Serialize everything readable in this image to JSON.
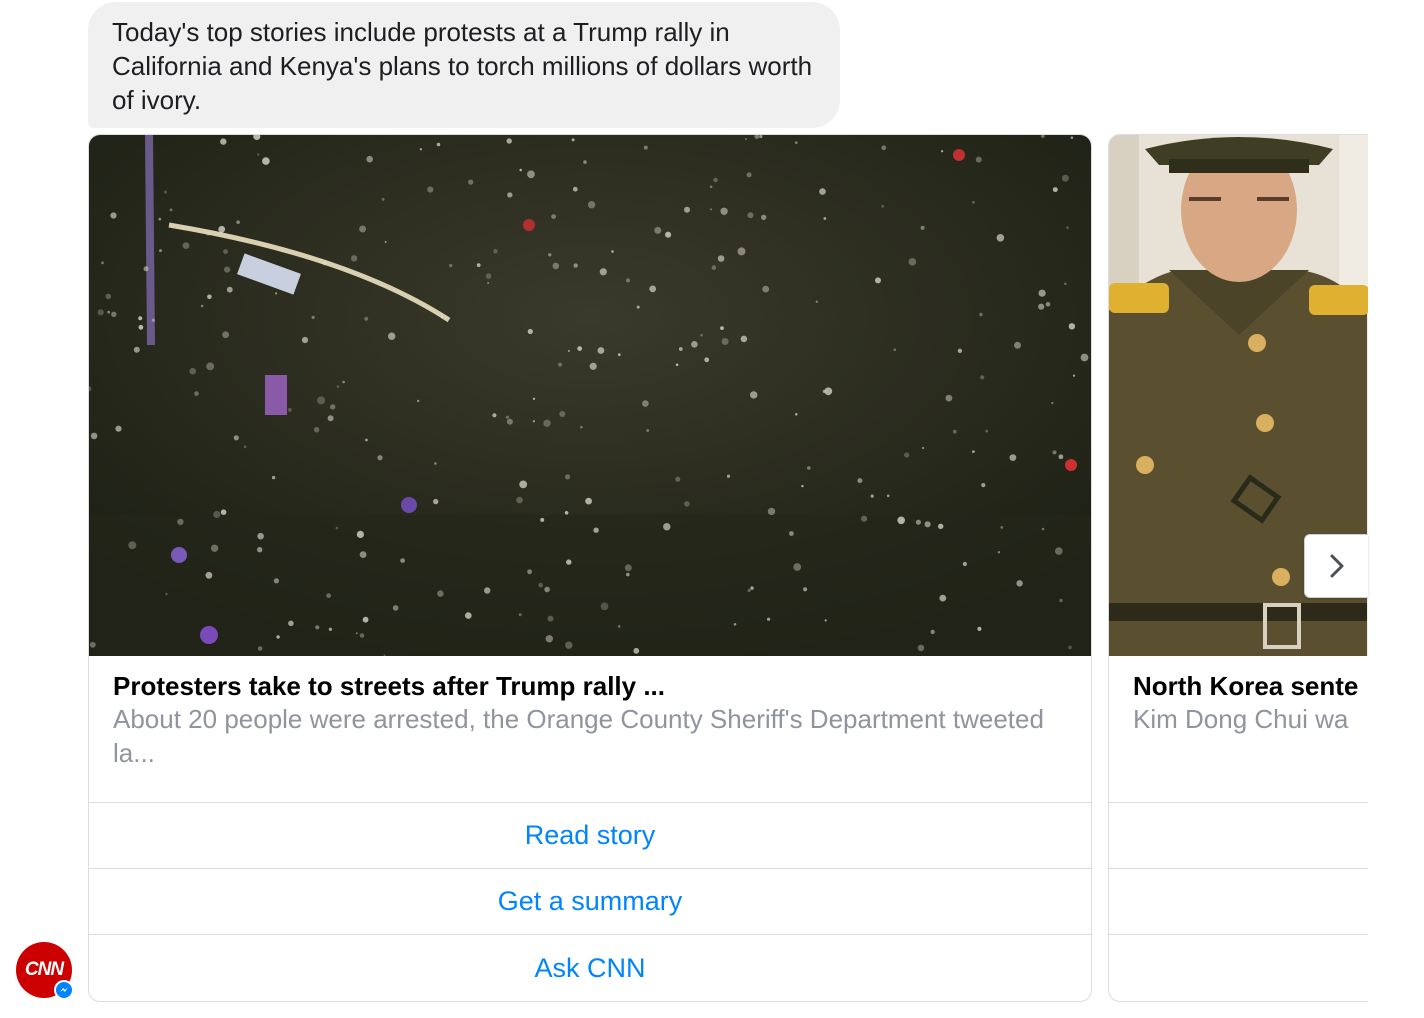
{
  "message": {
    "text": "Today's top stories include protests at a Trump rally in California and Kenya's plans to torch millions of dollars worth of ivory."
  },
  "cards": [
    {
      "title": "Protesters take to streets after Trump rally ...",
      "description": "About 20 people were arrested, the Orange County Sheriff's Department tweeted la...",
      "image": "night street crowd of protesters",
      "buttons": [
        "Read story",
        "Get a summary",
        "Ask CNN"
      ]
    },
    {
      "title": "North Korea sente",
      "description": "Kim Dong Chui wa",
      "image": "north korean military officer in uniform"
    }
  ],
  "sender": {
    "avatar_text": "CNN",
    "badge_icon": "messenger-icon"
  },
  "carousel": {
    "next_icon": "chevron-right-icon"
  }
}
